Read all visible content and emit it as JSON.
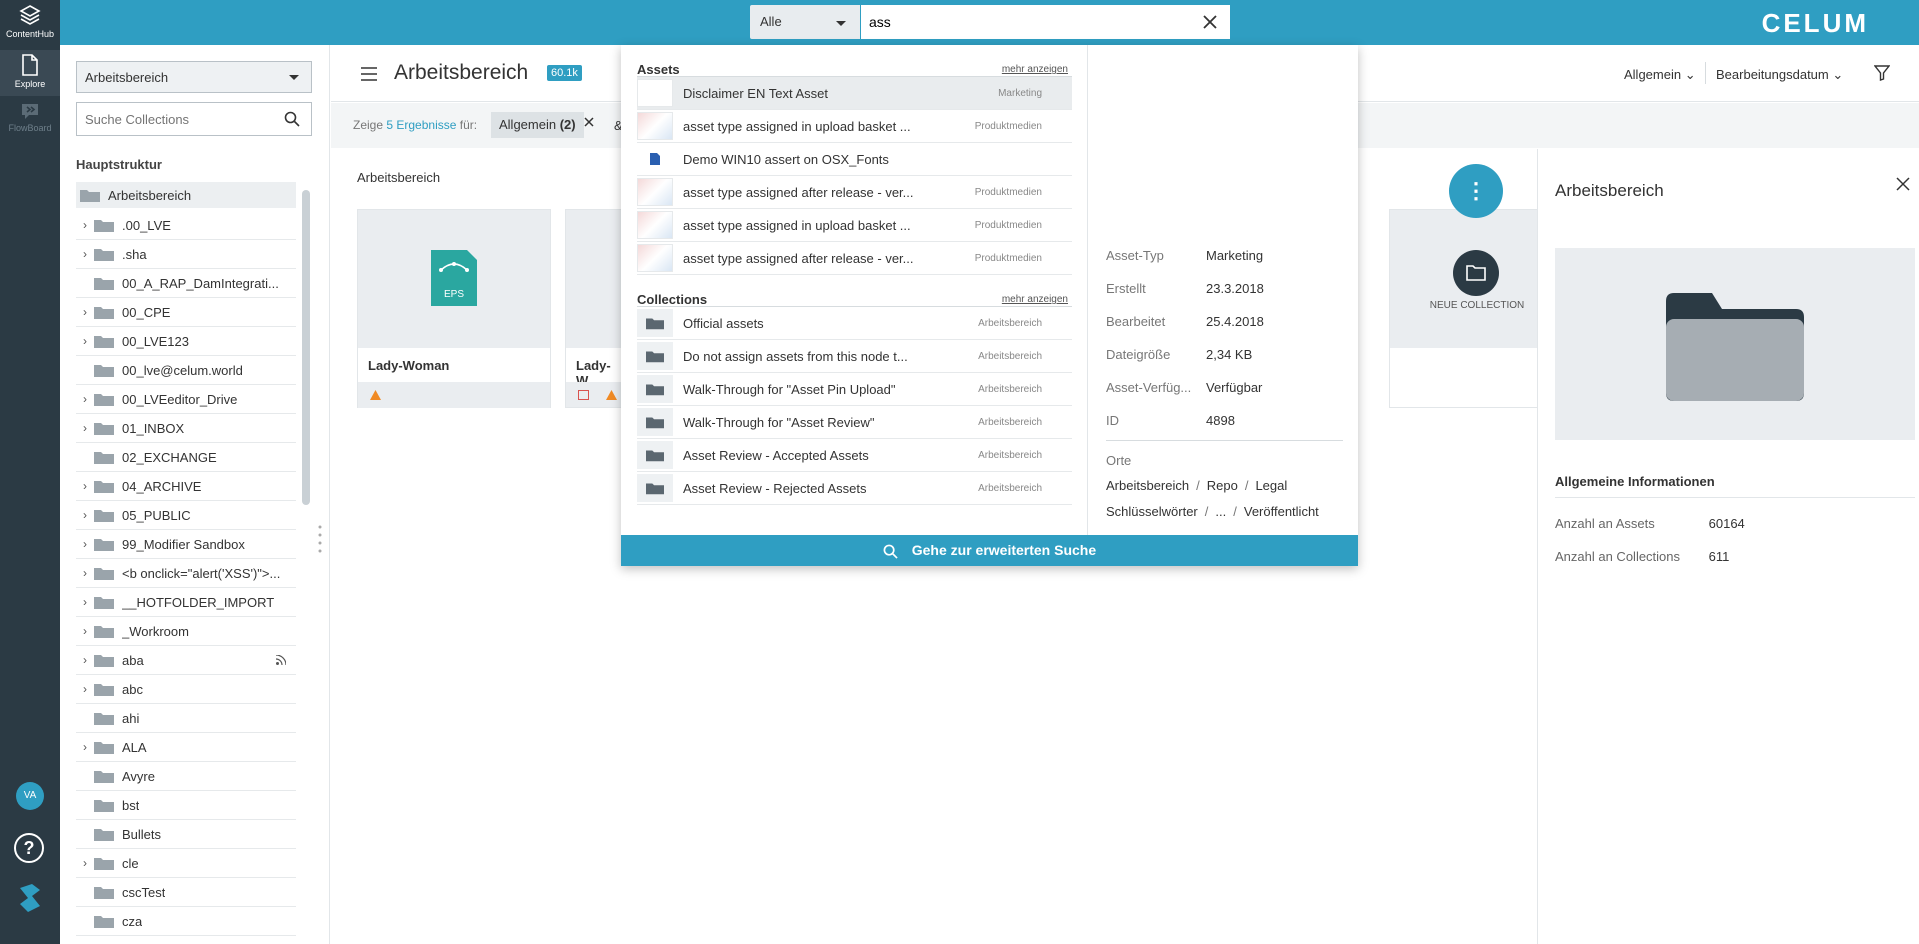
{
  "rail": {
    "brand_label": "ContentHub",
    "explore_label": "Explore",
    "flowboard_label": "FlowBoard",
    "avatar_initials": "VA",
    "help_glyph": "?"
  },
  "topbar": {
    "brand": "CELUM",
    "search_scope": "Alle",
    "search_value": "ass",
    "accent_color": "#2f9ec2"
  },
  "left_panel": {
    "workspace_select": "Arbeitsbereich",
    "search_placeholder": "Suche Collections",
    "tree_title": "Hauptstruktur",
    "root": "Arbeitsbereich",
    "items": [
      {
        "label": ".00_LVE",
        "expandable": true
      },
      {
        "label": ".sha",
        "expandable": true
      },
      {
        "label": "00_A_RAP_DamIntegrati...",
        "expandable": false
      },
      {
        "label": "00_CPE",
        "expandable": true
      },
      {
        "label": "00_LVE123",
        "expandable": true
      },
      {
        "label": "00_lve@celum.world",
        "expandable": false
      },
      {
        "label": "00_LVEeditor_Drive",
        "expandable": true
      },
      {
        "label": "01_INBOX",
        "expandable": true
      },
      {
        "label": "02_EXCHANGE",
        "expandable": false
      },
      {
        "label": "04_ARCHIVE",
        "expandable": true
      },
      {
        "label": "05_PUBLIC",
        "expandable": true
      },
      {
        "label": "99_Modifier Sandbox",
        "expandable": true
      },
      {
        "label": "<b onclick=\"alert('XSS')\">...",
        "expandable": true
      },
      {
        "label": "__HOTFOLDER_IMPORT",
        "expandable": true
      },
      {
        "label": "_Workroom",
        "expandable": true
      },
      {
        "label": "aba",
        "expandable": true,
        "rss": true
      },
      {
        "label": "abc",
        "expandable": true
      },
      {
        "label": "ahi",
        "expandable": false
      },
      {
        "label": "ALA",
        "expandable": true
      },
      {
        "label": "Avyre",
        "expandable": false
      },
      {
        "label": "bst",
        "expandable": false
      },
      {
        "label": "Bullets",
        "expandable": false
      },
      {
        "label": "cle",
        "expandable": true
      },
      {
        "label": "cscTest",
        "expandable": false
      },
      {
        "label": "cza",
        "expandable": false
      }
    ]
  },
  "main": {
    "title": "Arbeitsbereich",
    "count_badge": "60.1k",
    "sort_general": "Allgemein",
    "sort_date": "Bearbeitungsdatum",
    "results_prefix": "Zeige",
    "results_count": "5 Ergebnisse",
    "results_suffix": "für:",
    "chip_label": "Allgemein",
    "chip_count": "(2)",
    "chip_amp": "&",
    "breadcrumb": "Arbeitsbereich",
    "card_1_name": "Lady-Woman",
    "card_1_format": "EPS",
    "card_2_name": "Lady-W",
    "fab_glyph": "⋮",
    "new_collection_label": "NEUE COLLECTION"
  },
  "info_panel": {
    "title": "Arbeitsbereich",
    "heading": "Allgemeine Informationen",
    "assets_label": "Anzahl an Assets",
    "assets_value": "60164",
    "collections_label": "Anzahl an Collections",
    "collections_value": "611"
  },
  "dropdown": {
    "assets_title": "Assets",
    "assets_more": "mehr anzeigen",
    "assets": [
      {
        "name": "Disclaimer EN Text Asset",
        "tag": "Marketing",
        "thumb": "blank",
        "active": true
      },
      {
        "name": "asset type assigned in upload basket ...",
        "tag": "Produktmedien",
        "thumb": "img"
      },
      {
        "name": "Demo WIN10 assert on OSX_Fonts",
        "tag": "",
        "thumb": "doc"
      },
      {
        "name": "asset type assigned after release - ver...",
        "tag": "Produktmedien",
        "thumb": "img"
      },
      {
        "name": "asset type assigned in upload basket ...",
        "tag": "Produktmedien",
        "thumb": "img"
      },
      {
        "name": "asset type assigned after release - ver...",
        "tag": "Produktmedien",
        "thumb": "img"
      }
    ],
    "collections_title": "Collections",
    "collections_more": "mehr anzeigen",
    "collections": [
      {
        "name": "Official assets",
        "tag": "Arbeitsbereich"
      },
      {
        "name": "Do not assign assets from this node t...",
        "tag": "Arbeitsbereich"
      },
      {
        "name": "Walk-Through for \"Asset Pin Upload\"",
        "tag": "Arbeitsbereich"
      },
      {
        "name": "Walk-Through for \"Asset Review\"",
        "tag": "Arbeitsbereich"
      },
      {
        "name": "Asset Review - Accepted Assets",
        "tag": "Arbeitsbereich"
      },
      {
        "name": "Asset Review - Rejected Assets",
        "tag": "Arbeitsbereich"
      }
    ],
    "detail": {
      "rows": [
        {
          "k": "Asset-Typ",
          "v": "Marketing"
        },
        {
          "k": "Erstellt",
          "v": "23.3.2018"
        },
        {
          "k": "Bearbeitet",
          "v": "25.4.2018"
        },
        {
          "k": "Dateigröße",
          "v": "2,34 KB"
        },
        {
          "k": "Asset-Verfüg...",
          "v": "Verfügbar"
        },
        {
          "k": "ID",
          "v": "4898"
        }
      ],
      "orte_label": "Orte",
      "path_1": [
        "Arbeitsbereich",
        "Repo",
        "Legal"
      ],
      "path_2": [
        "Schlüsselwörter",
        "...",
        "Veröffentlicht"
      ]
    },
    "footer": "Gehe zur erweiterten Suche"
  }
}
